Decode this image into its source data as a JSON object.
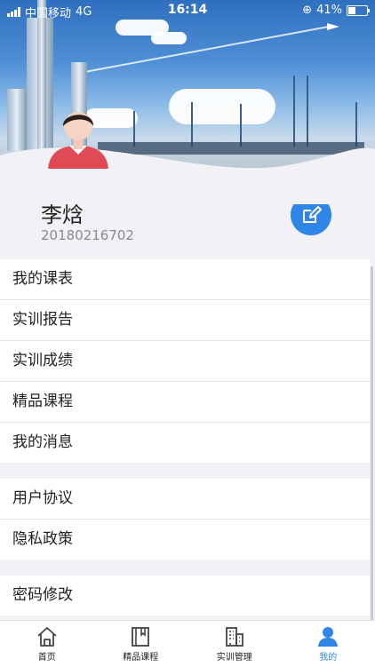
{
  "status_bar": {
    "carrier": "中国移动",
    "network": "4G",
    "time": "16:14",
    "battery": "41%"
  },
  "profile": {
    "name": "李焓",
    "student_id": "20180216702"
  },
  "menu_groups": [
    [
      "我的课表",
      "实训报告",
      "实训成绩",
      "精品课程",
      "我的消息"
    ],
    [
      "用户协议",
      "隐私政策"
    ],
    [
      "密码修改"
    ]
  ],
  "tabs": [
    {
      "label": "首页",
      "icon": "home-icon"
    },
    {
      "label": "精品课程",
      "icon": "book-icon"
    },
    {
      "label": "实训管理",
      "icon": "building-icon"
    },
    {
      "label": "我的",
      "icon": "user-icon"
    }
  ],
  "colors": {
    "accent": "#2f86e8",
    "background": "#f2f2f6"
  }
}
